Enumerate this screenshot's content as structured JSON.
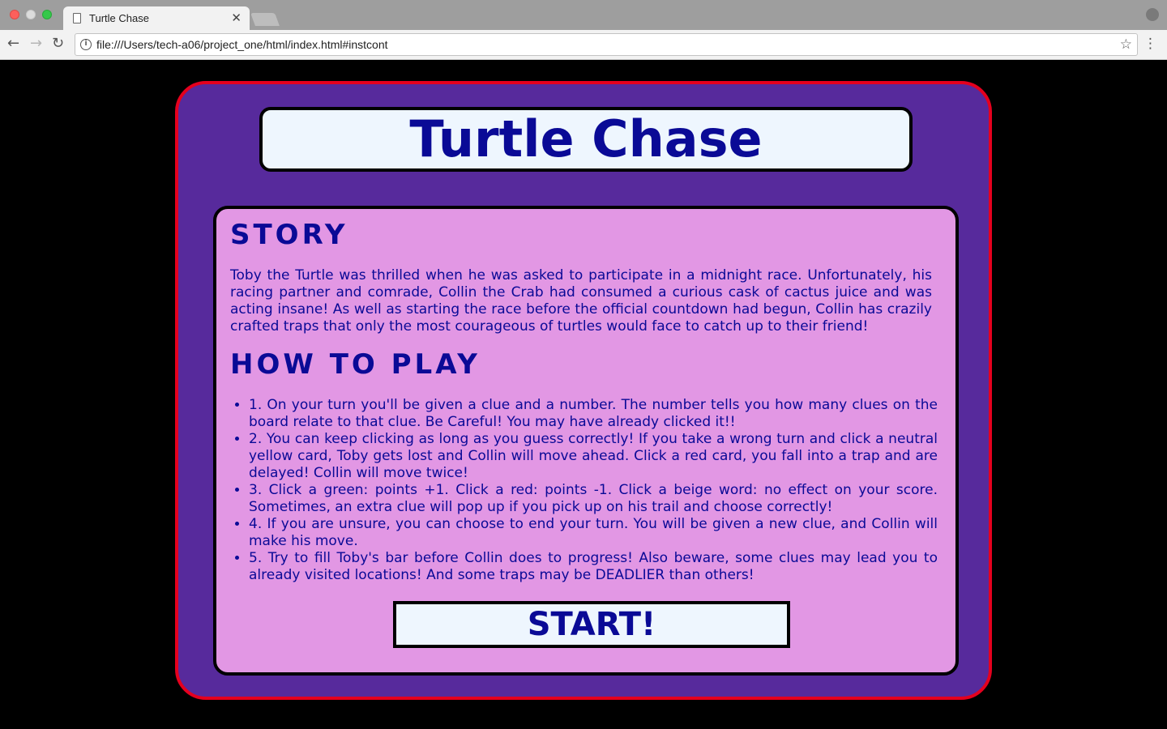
{
  "browser": {
    "tab_title": "Turtle Chase",
    "tab_close": "✕",
    "url": "file:///Users/tech-a06/project_one/html/index.html#instcont",
    "back_glyph": "←",
    "forward_glyph": "→",
    "reload_glyph": "↻",
    "info_glyph": "i",
    "star_glyph": "☆",
    "menu_glyph": "⋮"
  },
  "game": {
    "title": "Turtle Chase",
    "story_heading": "STORY",
    "story_text": "Toby the Turtle was thrilled when he was asked to participate in a midnight race. Unfortunately, his racing partner and comrade, Collin the Crab had consumed a curious cask of cactus juice and was acting insane! As well as starting the race before the official countdown had begun, Collin has crazily crafted traps that only the most courageous of turtles would face to catch up to their friend!",
    "howto_heading": "HOW TO PLAY",
    "rules": [
      "1. On your turn you'll be given a clue and a number. The number tells you how many clues on the board relate to that clue. Be Careful! You may have already clicked it!!",
      "2. You can keep clicking as long as you guess correctly! If you take a wrong turn and click a neutral yellow card, Toby gets lost and Collin will move ahead. Click a red card, you fall into a trap and are delayed! Collin will move twice!",
      "3. Click a green: points +1. Click a red: points -1. Click a beige word: no effect on your score. Sometimes, an extra clue will pop up if you pick up on his trail and choose correctly!",
      "4. If you are unsure, you can choose to end your turn. You will be given a new clue, and Collin will make his move.",
      "5. Try to fill Toby's bar before Collin does to progress! Also beware, some clues may lead you to already visited locations! And some traps may be DEADLIER than others!"
    ],
    "start_label": "START!"
  },
  "colors": {
    "page_bg": "#000000",
    "outer_panel": "#572a9c",
    "outer_border": "#e5001e",
    "inner_panel": "#e297e4",
    "title_box": "#eef6fe",
    "text": "#0a0a96"
  }
}
